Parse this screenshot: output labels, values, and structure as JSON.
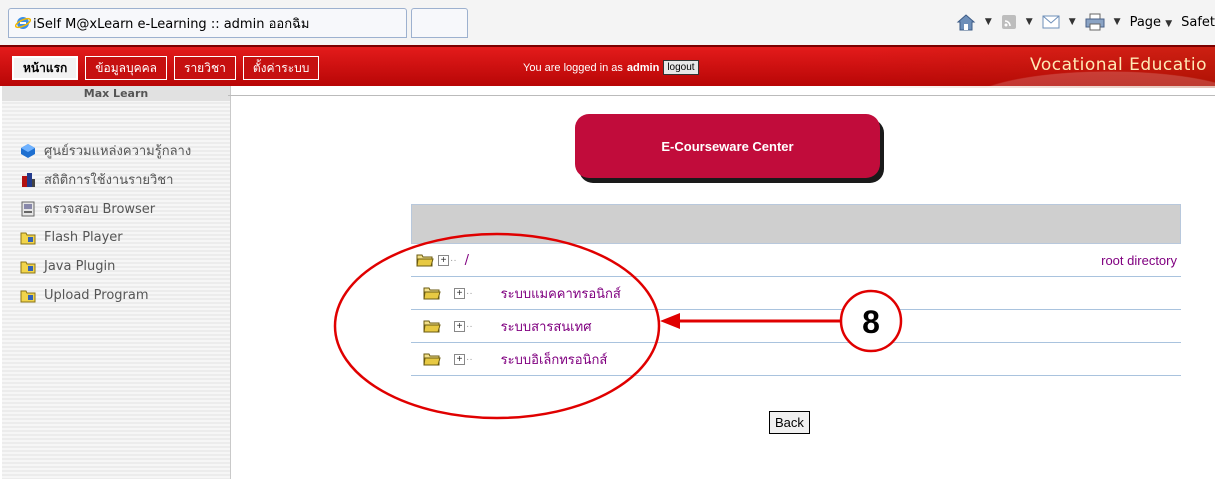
{
  "browser": {
    "tab_title": "iSelf M@xLearn e-Learning :: admin ออกฉิม",
    "tools": {
      "page_label": "Page",
      "safety_label": "Safet"
    }
  },
  "header": {
    "menu": [
      {
        "label": "หน้าแรก",
        "active": true
      },
      {
        "label": "ข้อมูลบุคคล",
        "active": false
      },
      {
        "label": "รายวิชา",
        "active": false
      },
      {
        "label": "ตั้งค่าระบบ",
        "active": false
      }
    ],
    "logged_prefix": "You are logged in as",
    "logged_user": "admin",
    "logout_label": "logout",
    "site_name": "Vocational Educatio"
  },
  "sidebar": {
    "heading": "Max Learn",
    "items": [
      {
        "label": "ศูนย์รวมแหล่งความรู้กลาง",
        "icon": "cube-icon"
      },
      {
        "label": "สถิติการใช้งานรายวิชา",
        "icon": "stats-icon"
      },
      {
        "label": "ตรวจสอบ Browser",
        "icon": "browser-check-icon"
      },
      {
        "label": "Flash Player",
        "icon": "folder-icon"
      },
      {
        "label": "Java Plugin",
        "icon": "folder-icon"
      },
      {
        "label": "Upload Program",
        "icon": "folder-icon"
      }
    ]
  },
  "main": {
    "center_title": "E-Courseware Center",
    "root_path": "/",
    "root_label": "root directory",
    "folders": [
      "ระบบแมคคาทรอนิกส์",
      "ระบบสารสนเทศ",
      "ระบบอิเล็กทรอนิกส์"
    ],
    "back_label": "Back"
  },
  "annotation": {
    "number": "8",
    "color": "#e00000"
  }
}
